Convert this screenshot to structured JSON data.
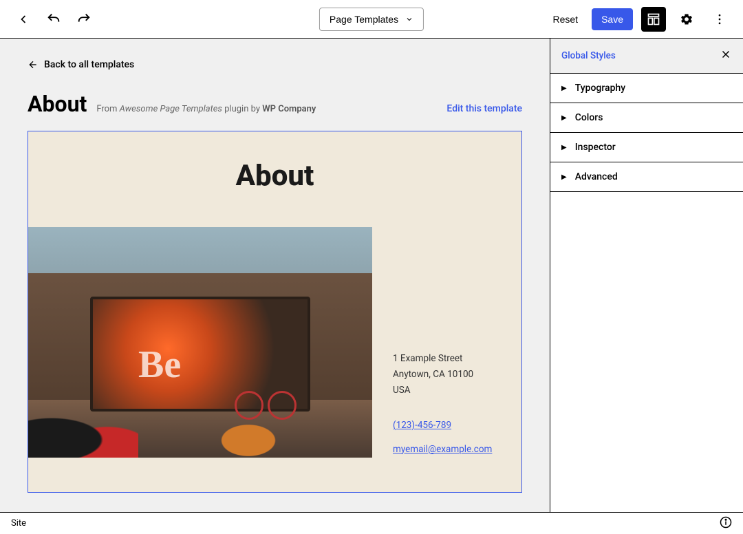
{
  "topbar": {
    "dropdown_label": "Page Templates",
    "reset": "Reset",
    "save": "Save"
  },
  "main": {
    "back": "Back to all templates",
    "title": "About",
    "meta_from": "From ",
    "meta_plugin": "Awesome Page Templates",
    "meta_by": " plugin by ",
    "meta_company": "WP Company",
    "edit_link": "Edit  this template"
  },
  "preview": {
    "heading": "About",
    "be_text": "Be",
    "addr1": "1 Example Street",
    "addr2": "Anytown, CA 10100",
    "addr3": "USA",
    "phone": "(123)-456-789",
    "email": "myemail@example.com"
  },
  "sidebar": {
    "title": "Global Styles",
    "panels": [
      "Typography",
      "Colors",
      "Inspector",
      "Advanced"
    ]
  },
  "footer": {
    "label": "Site"
  }
}
